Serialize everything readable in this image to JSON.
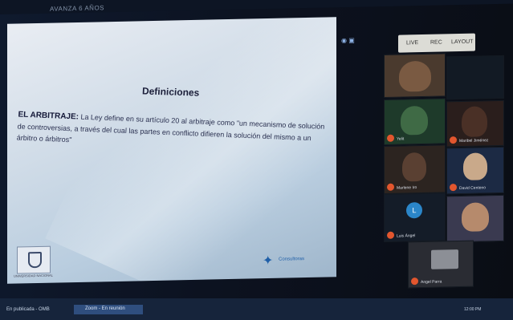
{
  "window": {
    "title": "AVANZA 6 AÑOS"
  },
  "slide": {
    "title": "Definiciones",
    "body_term": "EL ARBITRAJE:",
    "body_text": "La Ley define en su artículo 20 al arbitraje como \"un mecanismo de solución de controversias, a través del cual las partes en conflicto difieren la solución del mismo a un árbitro o árbitros\"",
    "logo_left_caption": "UNIVERSIDAD NACIONAL",
    "logo_right_text": "Consultoras"
  },
  "conference": {
    "toolbar_items": [
      "LIVE",
      "REC",
      "LAYOUT"
    ],
    "participants": [
      {
        "name": ""
      },
      {
        "name": ""
      },
      {
        "name": "Yelit"
      },
      {
        "name": "Maribel Jiménez"
      },
      {
        "name": "Marlene Iro"
      },
      {
        "name": "David Centeno"
      },
      {
        "name": "Luis Ángel",
        "initial": "L"
      },
      {
        "name": ""
      },
      {
        "name": "Angel Parra"
      }
    ]
  },
  "taskbar": {
    "item1": "En publicada - OMB",
    "item2": "Zoom - En reunión",
    "clock": "12:00 PM"
  },
  "colors": {
    "slide_bg": "#cfdbe7",
    "name_badge": "#e2562e",
    "taskbar": "#16243b",
    "avatar": "#2b86c9"
  }
}
